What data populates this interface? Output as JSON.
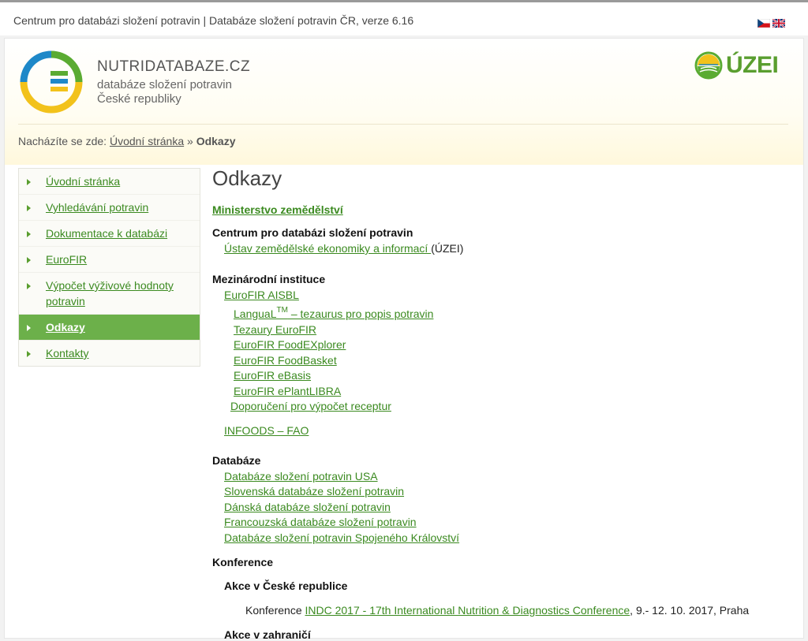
{
  "topbar": {
    "site_title": "Centrum pro databázi složení potravin | Databáze složení potravin ČR, verze 6.16"
  },
  "header": {
    "logo_line1": "NUTRIDATABAZE.CZ",
    "logo_line2": "databáze složení potravin",
    "logo_line3": "České republiky",
    "uzei_text": "ÚZEI"
  },
  "breadcrumb": {
    "prefix": "Nacházíte se zde:",
    "home": "Úvodní stránka",
    "sep": "»",
    "current": "Odkazy"
  },
  "sidebar": {
    "items": [
      {
        "label": "Úvodní stránka"
      },
      {
        "label": "Vyhledávání potravin"
      },
      {
        "label": "Dokumentace k databázi"
      },
      {
        "label": "EuroFIR"
      },
      {
        "label": "Výpočet výživové hodnoty potravin"
      },
      {
        "label": "Odkazy",
        "active": true
      },
      {
        "label": "Kontakty"
      }
    ]
  },
  "content": {
    "title": "Odkazy",
    "ministry_link": "Ministerstvo zemědělství",
    "center_heading": "Centrum pro databázi složení potravin",
    "uzei_link": "Ústav zemědělské ekonomiky a informací ",
    "uzei_suffix": "(ÚZEI)",
    "intl_heading": "Mezinárodní instituce",
    "eurofir_aisbl": "EuroFIR AISBL",
    "langual_prefix": "LanguaL",
    "langual_tm": "TM",
    "langual_rest": " – tezaurus pro popis potravin",
    "tezaury": "Tezaury EuroFIR",
    "foodexplorer": "EuroFIR FoodEXplorer",
    "foodbasket": "EuroFIR FoodBasket",
    "ebasis": "EuroFIR eBasis",
    "eplantlibra": "EuroFIR ePlantLIBRA",
    "doporuceni": "Doporučení pro výpočet receptur",
    "infoods": "INFOODS – FAO",
    "db_heading": "Databáze",
    "db_links": [
      "Databáze složení potravin USA",
      "Slovenská databáze složení potravin",
      "Dánská databáze složení potravin",
      "Francouzská databáze složení potravin",
      "Databáze složení potravin Spojeného Království"
    ],
    "conf_heading": "Konference",
    "cz_events_heading": "Akce v České republice",
    "conf_prefix": "Konference ",
    "conf_link": "INDC 2017 - 17th International Nutrition & Diagnostics Conference",
    "conf_suffix": ", 9.- 12. 10. 2017, Praha",
    "abroad_heading": "Akce v zahraničí"
  },
  "colors": {
    "link_green": "#3b8a20",
    "active_nav": "#6cb04a",
    "logo_blue": "#1e88c8",
    "logo_green": "#5aab32",
    "logo_yellow": "#f2c21b"
  }
}
